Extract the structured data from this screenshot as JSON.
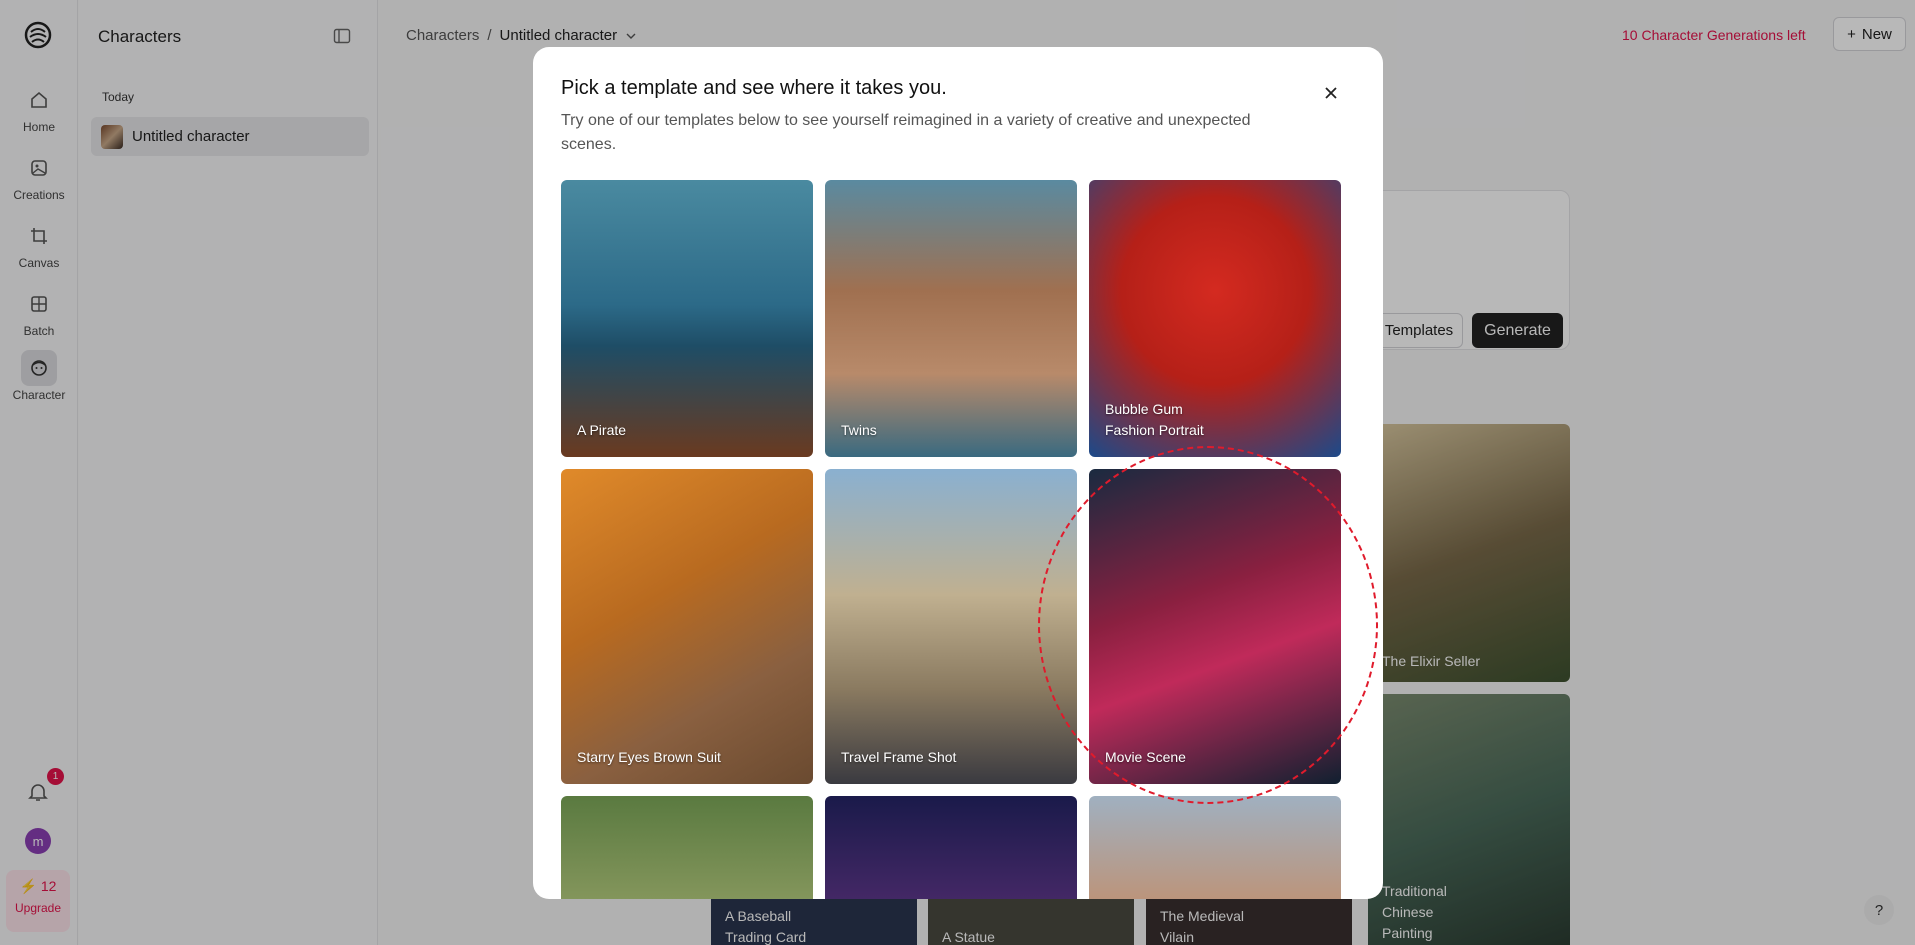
{
  "rail": {
    "items": [
      {
        "label": "Home",
        "icon": "home-icon"
      },
      {
        "label": "Creations",
        "icon": "image-icon"
      },
      {
        "label": "Canvas",
        "icon": "crop-icon"
      },
      {
        "label": "Batch",
        "icon": "grid-icon"
      },
      {
        "label": "Character",
        "icon": "face-icon"
      }
    ],
    "notifications_count": "1",
    "avatar_letter": "m",
    "credits": "12",
    "upgrade_label": "Upgrade"
  },
  "sidebar": {
    "title": "Characters",
    "section": "Today",
    "item_label": "Untitled character"
  },
  "header": {
    "crumb_root": "Characters",
    "crumb_sep": "/",
    "crumb_current": "Untitled character",
    "generations_left": "10 Character Generations left",
    "new_label": "New"
  },
  "background": {
    "templates_label": "Templates",
    "generate_label": "Generate",
    "cards": [
      "The Elixir Seller",
      "Traditional Chinese Painting",
      "A Baseball Trading Card",
      "A Statue",
      "The Medieval Vilain"
    ],
    "help_label": "?"
  },
  "modal": {
    "title": "Pick a template and see where it takes you.",
    "description": "Try one of our templates below to see yourself reimagined in a variety of creative and unexpected scenes.",
    "tiles": [
      "A Pirate",
      "Twins",
      "Bubble Gum Fashion Portrait",
      "Starry Eyes Brown Suit",
      "Travel Frame Shot",
      "Movie Scene",
      "",
      "",
      ""
    ]
  },
  "colors": {
    "accent": "#e5134b",
    "highlight_ring": "#e01b2c"
  }
}
